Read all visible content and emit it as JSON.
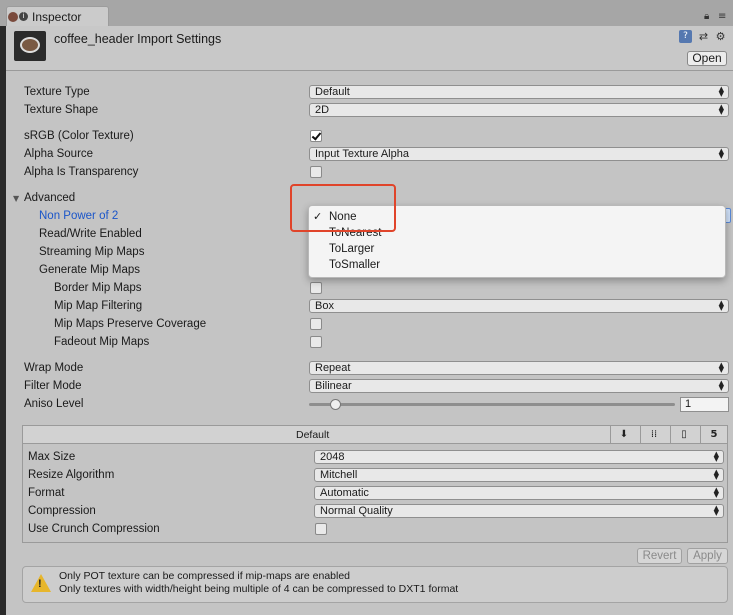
{
  "tab": {
    "title": "Inspector"
  },
  "header": {
    "title": "coffee_header Import Settings",
    "open_label": "Open"
  },
  "rows": {
    "texture_type": {
      "label": "Texture Type",
      "value": "Default"
    },
    "texture_shape": {
      "label": "Texture Shape",
      "value": "2D"
    },
    "srgb": {
      "label": "sRGB (Color Texture)",
      "checked": true
    },
    "alpha_source": {
      "label": "Alpha Source",
      "value": "Input Texture Alpha"
    },
    "alpha_transparency": {
      "label": "Alpha Is Transparency",
      "checked": false
    },
    "advanced": {
      "label": "Advanced"
    },
    "npot": {
      "label": "Non Power of 2"
    },
    "read_write": {
      "label": "Read/Write Enabled"
    },
    "streaming": {
      "label": "Streaming Mip Maps"
    },
    "gen_mip": {
      "label": "Generate Mip Maps"
    },
    "border_mip": {
      "label": "Border Mip Maps",
      "checked": false
    },
    "mip_filter": {
      "label": "Mip Map Filtering",
      "value": "Box"
    },
    "mip_coverage": {
      "label": "Mip Maps Preserve Coverage",
      "checked": false
    },
    "fadeout": {
      "label": "Fadeout Mip Maps",
      "checked": false
    },
    "wrap": {
      "label": "Wrap Mode",
      "value": "Repeat"
    },
    "filter": {
      "label": "Filter Mode",
      "value": "Bilinear"
    },
    "aniso": {
      "label": "Aniso Level",
      "value": "1",
      "fraction": 0.06
    }
  },
  "npot_popup": {
    "options": [
      "None",
      "ToNearest",
      "ToLarger",
      "ToSmaller"
    ],
    "selected": "None"
  },
  "platform": {
    "title": "Default",
    "max_size": {
      "label": "Max Size",
      "value": "2048"
    },
    "resize": {
      "label": "Resize Algorithm",
      "value": "Mitchell"
    },
    "format": {
      "label": "Format",
      "value": "Automatic"
    },
    "compression": {
      "label": "Compression",
      "value": "Normal Quality"
    },
    "crunch": {
      "label": "Use Crunch Compression",
      "checked": false
    }
  },
  "buttons": {
    "revert": "Revert",
    "apply": "Apply"
  },
  "message": {
    "line1": "Only POT texture can be compressed if mip-maps are enabled",
    "line2": "Only textures with width/height being multiple of 4 can be compressed to DXT1 format"
  },
  "colors": {
    "highlight": "#e0442a",
    "warning": "#e7b62c",
    "link_blue": "#1a55c9"
  }
}
